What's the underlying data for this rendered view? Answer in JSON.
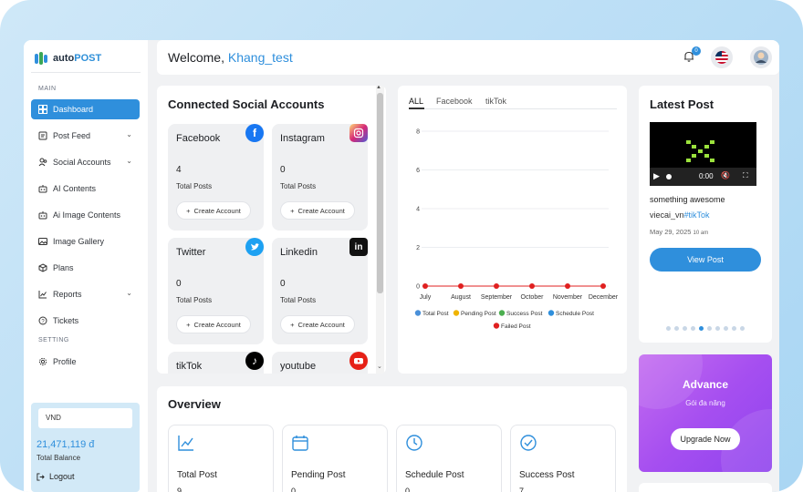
{
  "brand": {
    "logo_prefix": "auto",
    "logo_suffix": "POST"
  },
  "sidebar": {
    "section_main": "MAIN",
    "section_setting": "SETTING",
    "items": [
      {
        "label": "Dashboard",
        "icon": "dashboard-icon"
      },
      {
        "label": "Post Feed",
        "icon": "post-feed-icon"
      },
      {
        "label": "Social Accounts",
        "icon": "users-icon"
      },
      {
        "label": "AI Contents",
        "icon": "robot-icon"
      },
      {
        "label": "Ai Image Contents",
        "icon": "robot-icon"
      },
      {
        "label": "Image Gallery",
        "icon": "image-icon"
      },
      {
        "label": "Plans",
        "icon": "box-icon"
      },
      {
        "label": "Reports",
        "icon": "chart-icon"
      },
      {
        "label": "Tickets",
        "icon": "help-icon"
      }
    ],
    "profile": "Profile",
    "currency": "VND",
    "balance_amount": "21,471,119 đ",
    "balance_label": "Total Balance",
    "logout": "Logout"
  },
  "header": {
    "welcome": "Welcome,",
    "username": "Khang_test",
    "notification_count": "0"
  },
  "accounts": {
    "title": "Connected Social Accounts",
    "create_label": "Create Account",
    "total_label": "Total Posts",
    "cards": [
      {
        "name": "Facebook",
        "count": "4",
        "color": "#1877f2"
      },
      {
        "name": "Instagram",
        "count": "0",
        "color": "#d62976"
      },
      {
        "name": "Twitter",
        "count": "0",
        "color": "#1da1f2"
      },
      {
        "name": "Linkedin",
        "count": "0",
        "color": "#111111"
      },
      {
        "name": "tikTok",
        "count": "",
        "color": "#000000"
      },
      {
        "name": "youtube",
        "count": "",
        "color": "#e62117"
      }
    ]
  },
  "chart_tabs": [
    "ALL",
    "Facebook",
    "tikTok"
  ],
  "chart_data": {
    "type": "line",
    "categories": [
      "July",
      "August",
      "September",
      "October",
      "November",
      "December"
    ],
    "ylim": [
      0,
      8
    ],
    "yticks": [
      0,
      2,
      4,
      6,
      8
    ],
    "grid": true,
    "legend_position": "bottom",
    "series": [
      {
        "name": "Total Post",
        "color": "#4a90d9",
        "values": [
          0,
          0,
          0,
          0,
          0,
          0
        ]
      },
      {
        "name": "Pending Post",
        "color": "#f0b400",
        "values": [
          0,
          0,
          0,
          0,
          0,
          0
        ]
      },
      {
        "name": "Success Post",
        "color": "#4caf50",
        "values": [
          0,
          0,
          0,
          0,
          0,
          0
        ]
      },
      {
        "name": "Schedule Post",
        "color": "#2f8fdc",
        "values": [
          0,
          0,
          0,
          0,
          0,
          0
        ]
      },
      {
        "name": "Failed Post",
        "color": "#e02020",
        "values": [
          0,
          0,
          0,
          0,
          0,
          0
        ]
      }
    ]
  },
  "latest": {
    "title": "Latest Post",
    "video_time": "0:00",
    "post_title": "something awesome",
    "author": "viecai_vn",
    "tag": "#tikTok",
    "date": "May 29, 2025",
    "time": "10 am",
    "view_button": "View Post"
  },
  "advance": {
    "title": "Advance",
    "subtitle": "Gói đa năng",
    "button": "Upgrade Now"
  },
  "overview": {
    "title": "Overview",
    "cards": [
      {
        "label": "Total Post",
        "value": "9",
        "icon": "line-chart-icon"
      },
      {
        "label": "Pending Post",
        "value": "0",
        "icon": "calendar-icon"
      },
      {
        "label": "Schedule Post",
        "value": "0",
        "icon": "clock-icon"
      },
      {
        "label": "Success Post",
        "value": "7",
        "icon": "check-circle-icon"
      }
    ]
  }
}
